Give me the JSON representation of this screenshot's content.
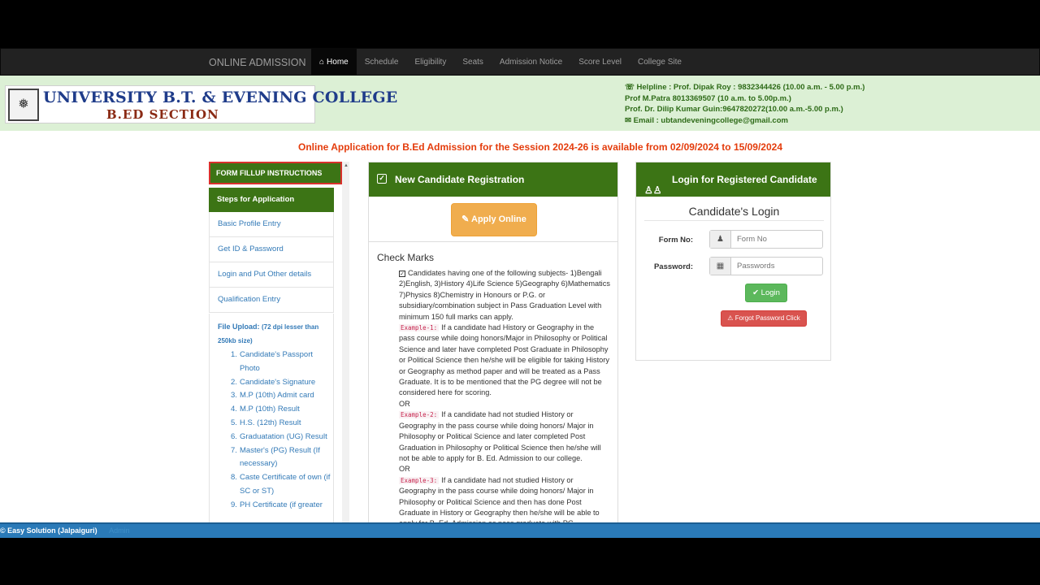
{
  "nav": {
    "brand": "ONLINE ADMISSION",
    "home": "Home",
    "links": [
      "Schedule",
      "Eligibility",
      "Seats",
      "Admission Notice",
      "Score Level",
      "College Site"
    ]
  },
  "logo": {
    "title": "UNIVERSITY B.T. & EVENING COLLEGE",
    "subtitle": "B.ED SECTION"
  },
  "contact": {
    "line1": "Helpline : Prof. Dipak Roy : 9832344426 (10.00 a.m. - 5.00 p.m.)",
    "line2": "Prof M.Patra 8013369507 (10 a.m. to 5.00p.m.)",
    "line3": "Prof. Dr. Dilip Kumar Guin:9647820272(10.00 a.m.-5.00 p.m.)",
    "line4": "Email : ubtandeveningcollege@gmail.com"
  },
  "announcement": "Online Application for B.Ed Admission for the Session 2024-26 is available from 02/09/2024 to 15/09/2024",
  "sidebar": {
    "instructions": "FORM FILLUP INSTRUCTIONS",
    "steps_heading": "Steps for Application",
    "steps": [
      "Basic Profile Entry",
      "Get ID & Password",
      "Login and Put Other details",
      "Qualification Entry"
    ],
    "upload_title": "File Upload:",
    "upload_note": "(72 dpi lesser than 250kb size)",
    "uploads": [
      {
        "num": "1.",
        "text": "Candidate's Passport Photo"
      },
      {
        "num": "2.",
        "text": "Candidate's Signature"
      },
      {
        "num": "3.",
        "text": "M.P (10th) Admit card"
      },
      {
        "num": "4.",
        "text": "M.P (10th) Result"
      },
      {
        "num": "5.",
        "text": "H.S. (12th) Result"
      },
      {
        "num": "6.",
        "text": "Graduatation (UG) Result"
      },
      {
        "num": "7.",
        "text": "Master's (PG) Result (If necessary)"
      },
      {
        "num": "8.",
        "text": "Caste Certificate of own (if SC or ST)"
      },
      {
        "num": "9.",
        "text": "PH Certificate (if greater"
      }
    ]
  },
  "registration": {
    "heading": "New Candidate Registration",
    "apply_label": "Apply Online",
    "check_title": "Check Marks",
    "intro": "Candidates having one of the following subjects- 1)Bengali 2)English, 3)History 4)Life Science 5)Geography 6)Mathematics 7)Physics 8)Chemistry in Honours or P.G. or subsidiary/combination subject in Pass Graduation Level with minimum 150 full marks can apply.",
    "ex1_label": "Example-1:",
    "ex1_text": "If a candidate had History or Geography in the pass course while doing honors/Major in Philosophy or Political Science and later have completed Post Graduate in Philosophy or Political Science then he/she will be eligible for taking History or Geography as method paper and will be treated as a Pass Graduate. It is to be mentioned that the PG degree will not be considered here for scoring.",
    "or1": "OR",
    "ex2_label": "Example-2:",
    "ex2_text": "If a candidate had not studied History or Geography in the pass course while doing honors/ Major in Philosophy or Political Science and later completed Post Graduation in Philosophy or Political Science then he/she will not be able to apply for B. Ed. Admission to our college.",
    "or2": "OR",
    "ex3_label": "Example-3:",
    "ex3_text": "If a candidate had not studied History or Geography in the pass course while doing honors/ Major in Philosophy or Political Science and then has done Post Graduate in History or Geography then he/she will be able to apply for B. Ed. Admission as pass graduate with PG"
  },
  "login": {
    "heading": "Login for Registered Candidate",
    "title": "Candidate's Login",
    "form_no_label": "Form No:",
    "form_no_placeholder": "Form No",
    "password_label": "Password:",
    "password_placeholder": "Passwords",
    "login_label": "Login",
    "forgot_label": "Forgot Password Click"
  },
  "footer": {
    "credit": "© Easy Solution (Jalpaiguri)",
    "extra": "Admin"
  }
}
